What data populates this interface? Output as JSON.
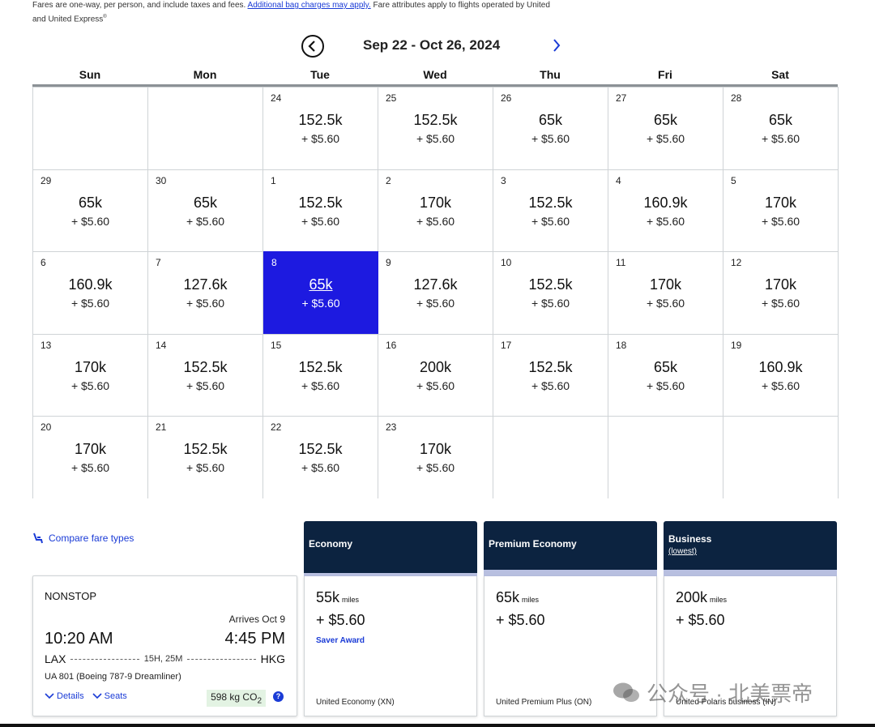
{
  "notice": {
    "text1": "Fares are one-way, per person, and include taxes and fees.",
    "link": "Additional bag charges may apply.",
    "text2": "Fare attributes apply to flights operated by United and United Express",
    "sup": "®"
  },
  "nav": {
    "range_title": "Sep 22 - Oct 26, 2024"
  },
  "days_of_week": [
    "Sun",
    "Mon",
    "Tue",
    "Wed",
    "Thu",
    "Fri",
    "Sat"
  ],
  "calendar": [
    {
      "day": "",
      "miles": "",
      "fee": ""
    },
    {
      "day": "",
      "miles": "",
      "fee": ""
    },
    {
      "day": "24",
      "miles": "152.5k",
      "fee": "+ $5.60"
    },
    {
      "day": "25",
      "miles": "152.5k",
      "fee": "+ $5.60"
    },
    {
      "day": "26",
      "miles": "65k",
      "fee": "+ $5.60"
    },
    {
      "day": "27",
      "miles": "65k",
      "fee": "+ $5.60"
    },
    {
      "day": "28",
      "miles": "65k",
      "fee": "+ $5.60"
    },
    {
      "day": "29",
      "miles": "65k",
      "fee": "+ $5.60"
    },
    {
      "day": "30",
      "miles": "65k",
      "fee": "+ $5.60"
    },
    {
      "day": "1",
      "miles": "152.5k",
      "fee": "+ $5.60"
    },
    {
      "day": "2",
      "miles": "170k",
      "fee": "+ $5.60"
    },
    {
      "day": "3",
      "miles": "152.5k",
      "fee": "+ $5.60"
    },
    {
      "day": "4",
      "miles": "160.9k",
      "fee": "+ $5.60"
    },
    {
      "day": "5",
      "miles": "170k",
      "fee": "+ $5.60"
    },
    {
      "day": "6",
      "miles": "160.9k",
      "fee": "+ $5.60"
    },
    {
      "day": "7",
      "miles": "127.6k",
      "fee": "+ $5.60"
    },
    {
      "day": "8",
      "miles": "65k",
      "fee": "+ $5.60",
      "selected": true
    },
    {
      "day": "9",
      "miles": "127.6k",
      "fee": "+ $5.60"
    },
    {
      "day": "10",
      "miles": "152.5k",
      "fee": "+ $5.60"
    },
    {
      "day": "11",
      "miles": "170k",
      "fee": "+ $5.60"
    },
    {
      "day": "12",
      "miles": "170k",
      "fee": "+ $5.60"
    },
    {
      "day": "13",
      "miles": "170k",
      "fee": "+ $5.60"
    },
    {
      "day": "14",
      "miles": "152.5k",
      "fee": "+ $5.60"
    },
    {
      "day": "15",
      "miles": "152.5k",
      "fee": "+ $5.60"
    },
    {
      "day": "16",
      "miles": "200k",
      "fee": "+ $5.60"
    },
    {
      "day": "17",
      "miles": "152.5k",
      "fee": "+ $5.60"
    },
    {
      "day": "18",
      "miles": "65k",
      "fee": "+ $5.60"
    },
    {
      "day": "19",
      "miles": "160.9k",
      "fee": "+ $5.60"
    },
    {
      "day": "20",
      "miles": "170k",
      "fee": "+ $5.60"
    },
    {
      "day": "21",
      "miles": "152.5k",
      "fee": "+ $5.60"
    },
    {
      "day": "22",
      "miles": "152.5k",
      "fee": "+ $5.60"
    },
    {
      "day": "23",
      "miles": "170k",
      "fee": "+ $5.60"
    },
    {
      "day": "",
      "miles": "",
      "fee": ""
    },
    {
      "day": "",
      "miles": "",
      "fee": ""
    },
    {
      "day": "",
      "miles": "",
      "fee": ""
    }
  ],
  "compare": {
    "label": "Compare fare types"
  },
  "flight": {
    "nonstop": "NONSTOP",
    "arrives": "Arrives Oct 9",
    "dep_time": "10:20 AM",
    "arr_time": "4:45 PM",
    "origin": "LAX",
    "destination": "HKG",
    "duration": "15H, 25M",
    "flight_info": "UA 801 (Boeing 787-9 Dreamliner)",
    "details_label": "Details",
    "seats_label": "Seats",
    "co2": "598 kg CO",
    "co2_sub": "2",
    "info_glyph": "?"
  },
  "fares": [
    {
      "title": "Economy",
      "sub": "",
      "miles": "55k",
      "unit": "miles",
      "fee": "+ $5.60",
      "saver": "Saver Award",
      "code": "United Economy (XN)"
    },
    {
      "title": "Premium Economy",
      "sub": "",
      "miles": "65k",
      "unit": "miles",
      "fee": "+ $5.60",
      "saver": "",
      "code": "United Premium Plus (ON)"
    },
    {
      "title": "Business",
      "sub": "(lowest)",
      "miles": "200k",
      "unit": "miles",
      "fee": "+ $5.60",
      "saver": "",
      "code": "United Polaris business (IN)"
    }
  ],
  "watermark": {
    "text": "公众号 · 北美票帝"
  },
  "colors": {
    "accent": "#1d1ae0",
    "link": "#1a3bd6",
    "navy": "#0c2340"
  }
}
